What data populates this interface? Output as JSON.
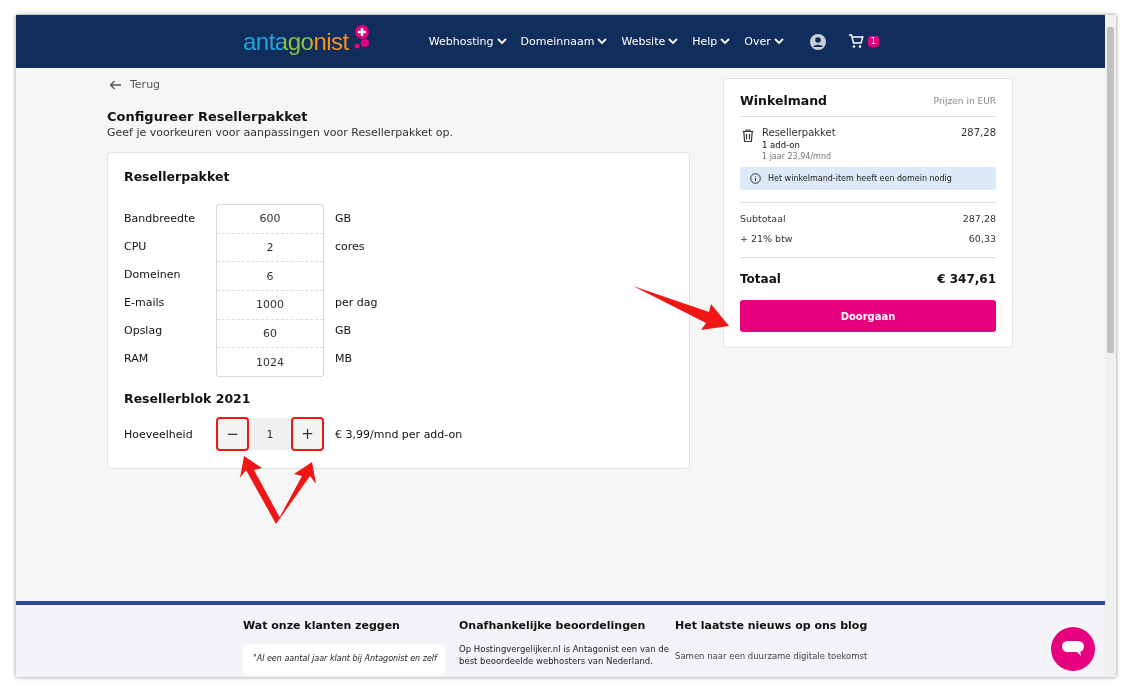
{
  "header": {
    "logo": "antagonist",
    "nav": [
      {
        "label": "Webhosting"
      },
      {
        "label": "Domeinnaam"
      },
      {
        "label": "Website"
      },
      {
        "label": "Help"
      },
      {
        "label": "Over"
      }
    ],
    "cart_count": "1"
  },
  "back": "Terug",
  "title": "Configureer Resellerpakket",
  "subtitle": "Geef je voorkeuren voor aanpassingen voor Resellerpakket op.",
  "package": {
    "heading": "Resellerpakket",
    "specs": [
      {
        "label": "Bandbreedte",
        "value": "600",
        "unit": "GB"
      },
      {
        "label": "CPU",
        "value": "2",
        "unit": "cores"
      },
      {
        "label": "Domeinen",
        "value": "6"
      },
      {
        "label": "E-mails",
        "value": "1000",
        "unit": "per dag"
      },
      {
        "label": "Opslag",
        "value": "60",
        "unit": "GB"
      },
      {
        "label": "RAM",
        "value": "1024",
        "unit": "MB"
      }
    ]
  },
  "addon": {
    "heading": "Resellerblok 2021",
    "label": "Hoeveelheid",
    "minus": "−",
    "quantity": "1",
    "plus": "+",
    "price": "€ 3,99/mnd per add-on"
  },
  "cart": {
    "title": "Winkelmand",
    "currency_note": "Prijzen in EUR",
    "item": {
      "name": "Resellerpakket",
      "price": "287,28",
      "addons": "1 add-on",
      "term": "1 jaar 23,94/mnd"
    },
    "notice": "Het winkelmand-item heeft een domein nodig",
    "lines": [
      {
        "label": "Subtotaal",
        "value": "287,28"
      },
      {
        "label": "+ 21% btw",
        "value": "60,33"
      }
    ],
    "total_label": "Totaal",
    "total": "€ 347,61",
    "button": "Doorgaan"
  },
  "footer": {
    "columns": [
      {
        "heading": "Wat onze klanten zeggen",
        "quote": "\"Al een aantal jaar klant bij Antagonist en zelf"
      },
      {
        "heading": "Onafhankelijke beoordelingen",
        "text": "Op Hostingvergelijker.nl is Antagonist een van de best beoordeelde webhosters van Nederland."
      },
      {
        "heading": "Het laatste nieuws op ons blog",
        "links": [
          "Samen naar een duurzame digitale toekomst"
        ]
      }
    ]
  }
}
